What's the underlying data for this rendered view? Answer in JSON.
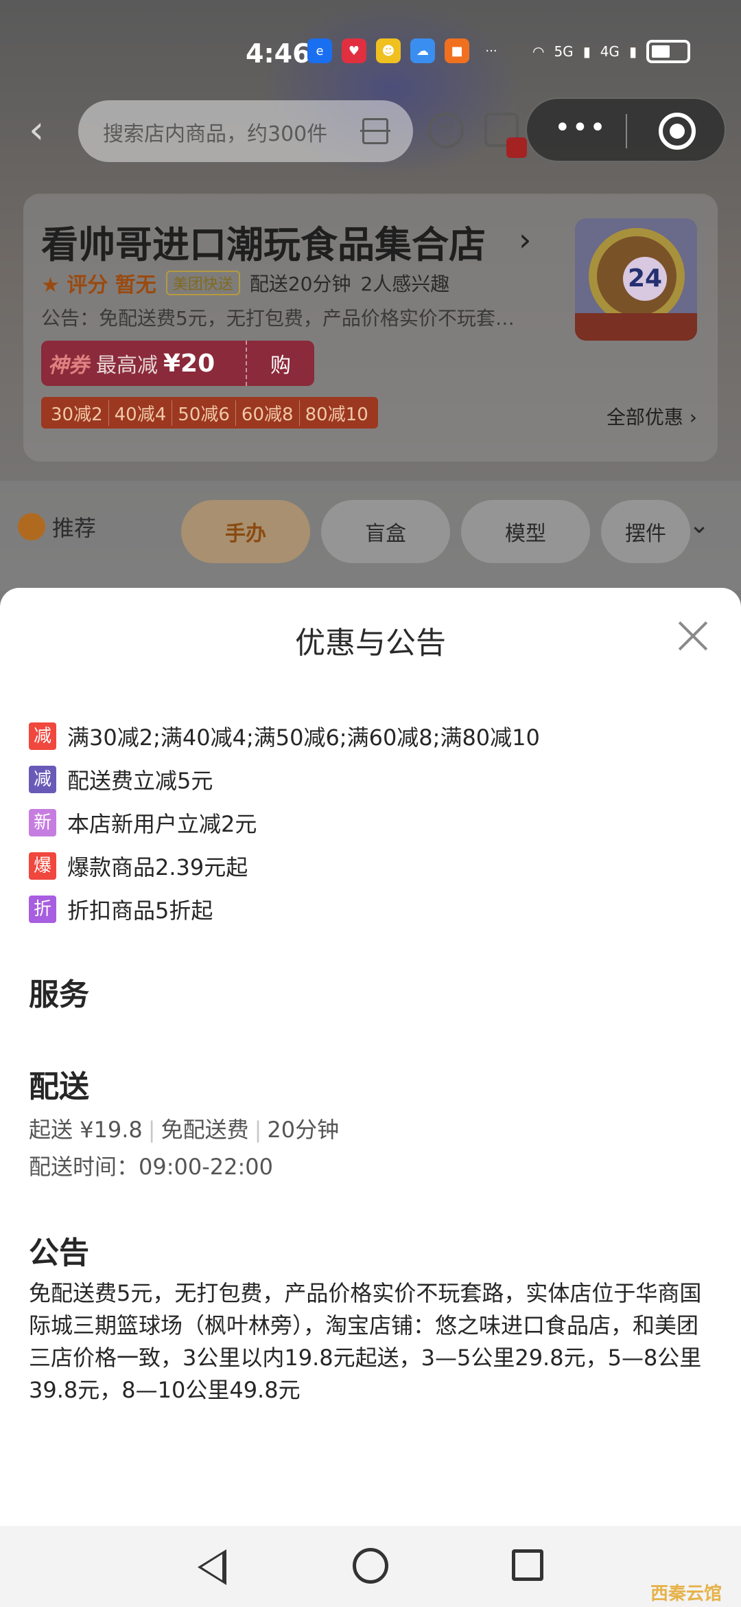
{
  "status_bar": {
    "time": "4:46",
    "net1": "5G",
    "net2": "4G"
  },
  "nav": {
    "search_placeholder": "搜索店内商品，约300件"
  },
  "store": {
    "name": "看帅哥进口潮玩食品集合店",
    "rating": "评分 暂无",
    "delivery_tag": "美团快送",
    "delivery_time": "配送20分钟",
    "interest": "2人感兴趣",
    "notice": "公告：免配送费5元，无打包费，产品价格实价不玩套…",
    "coupon": {
      "tag": "神券",
      "text": "最高减",
      "amount": "¥20",
      "buy": "购"
    },
    "discounts": [
      "30减2",
      "40减4",
      "50减6",
      "60减8",
      "80减10"
    ],
    "all_promos": "全部优惠",
    "logo_number": "24"
  },
  "categories": {
    "left": "推荐",
    "pills": [
      "手办",
      "盲盒",
      "模型",
      "摆件"
    ]
  },
  "sheet": {
    "title": "优惠与公告",
    "promos": [
      {
        "badge": "减",
        "color": "#f0473e",
        "text": "满30减2;满40减4;满50减6;满60减8;满80减10"
      },
      {
        "badge": "减",
        "color": "#6a5ab8",
        "text": "配送费立减5元"
      },
      {
        "badge": "新",
        "color": "#c57de0",
        "text": "本店新用户立减2元"
      },
      {
        "badge": "爆",
        "color": "#f0473e",
        "text": "爆款商品2.39元起"
      },
      {
        "badge": "折",
        "color": "#a85ee0",
        "text": "折扣商品5折起"
      }
    ],
    "service_heading": "服务",
    "delivery_heading": "配送",
    "delivery": {
      "min_order": "起送 ¥19.8",
      "fee": "免配送费",
      "time": "20分钟",
      "hours": "配送时间：09:00-22:00"
    },
    "announce_heading": "公告",
    "announcement": "免配送费5元，无打包费，产品价格实价不玩套路，实体店位于华商国际城三期篮球场（枫叶林旁），淘宝店铺：悠之味进口食品店，和美团三店价格一致，3公里以内19.8元起送，3—5公里29.8元，5—8公里39.8元，8—10公里49.8元"
  },
  "watermark": "西秦云馆"
}
